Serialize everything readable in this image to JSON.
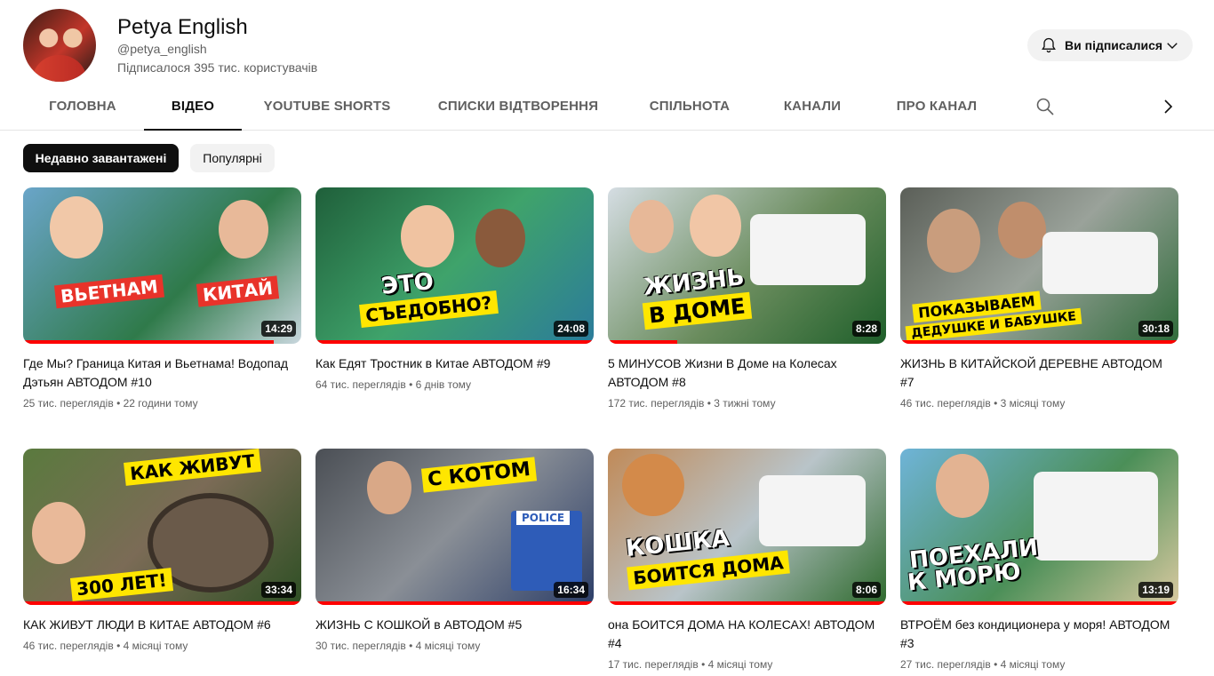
{
  "channel": {
    "name": "Petya English",
    "handle": "@petya_english",
    "subscribers": "Підписалося 395 тис. користувачів",
    "subscribe_label": "Ви підписалися"
  },
  "tabs": [
    {
      "label": "ГОЛОВНА"
    },
    {
      "label": "ВІДЕО"
    },
    {
      "label": "YOUTUBE SHORTS"
    },
    {
      "label": "СПИСКИ ВІДТВОРЕННЯ"
    },
    {
      "label": "СПІЛЬНОТА"
    },
    {
      "label": "КАНАЛИ"
    },
    {
      "label": "ПРО КАНАЛ"
    }
  ],
  "active_tab": "ВІДЕО",
  "chips": [
    {
      "label": "Недавно завантажені",
      "selected": true
    },
    {
      "label": "Популярні",
      "selected": false
    }
  ],
  "videos": [
    {
      "title": "Где Мы? Граница Китая и Вьетнама! Водопад Дэтьян АВТОДОМ #10",
      "views": "25 тис. переглядів",
      "age": "22 години тому",
      "duration": "14:29",
      "thumb_text": [
        "ВЬЕТНАМ",
        "КИТАЙ"
      ],
      "progress": 0.9
    },
    {
      "title": "Как Едят Тростник в Китае АВТОДОМ #9",
      "views": "64 тис. переглядів",
      "age": "6 днів тому",
      "duration": "24:08",
      "thumb_text": [
        "ЭТО",
        "СЪЕДОБНО?"
      ],
      "progress": 1.0
    },
    {
      "title": "5 МИНУСОВ Жизни В Доме на Колесах АВТОДОМ #8",
      "views": "172 тис. переглядів",
      "age": "3 тижні тому",
      "duration": "8:28",
      "thumb_text": [
        "ЖИЗНЬ",
        "В ДОМЕ"
      ],
      "progress": 0.25
    },
    {
      "title": "ЖИЗНЬ В КИТАЙСКОЙ ДЕРЕВНЕ АВТОДОМ #7",
      "views": "46 тис. переглядів",
      "age": "3 місяці тому",
      "duration": "30:18",
      "thumb_text": [
        "ПОКАЗЫВАЕМ",
        "ДЕДУШКЕ И БАБУШКЕ"
      ],
      "progress": 1.0
    },
    {
      "title": "КАК ЖИВУТ ЛЮДИ В КИТАЕ АВТОДОМ #6",
      "views": "46 тис. переглядів",
      "age": "4 місяці тому",
      "duration": "33:34",
      "thumb_text": [
        "КАК ЖИВУТ",
        "300 ЛЕТ!"
      ],
      "progress": 1.0
    },
    {
      "title": "ЖИЗНЬ С КОШКОЙ в АВТОДОМ #5",
      "views": "30 тис. переглядів",
      "age": "4 місяці тому",
      "duration": "16:34",
      "thumb_text": [
        "С КОТОМ",
        "POLICE"
      ],
      "progress": 1.0
    },
    {
      "title": "она БОИТСЯ ДОМА НА КОЛЕСАХ! АВТОДОМ #4",
      "views": "17 тис. переглядів",
      "age": "4 місяці тому",
      "duration": "8:06",
      "thumb_text": [
        "КОШКА",
        "БОИТСЯ ДОМА"
      ],
      "progress": 1.0
    },
    {
      "title": "ВТРОЁМ без кондиционера у моря! АВТОДОМ #3",
      "views": "27 тис. переглядів",
      "age": "4 місяці тому",
      "duration": "13:19",
      "thumb_text": [
        "ПОЕХАЛИ",
        "К МОРЮ"
      ],
      "progress": 1.0
    }
  ],
  "colors": {
    "accent": "#ff0000",
    "chip_selected": "#0f0f0f",
    "chip": "#f2f2f2",
    "meta": "#606060"
  },
  "icons": {
    "subscribe": "bell-icon",
    "dropdown": "chevron-down-icon",
    "search": "search-icon",
    "next": "chevron-right-icon"
  }
}
